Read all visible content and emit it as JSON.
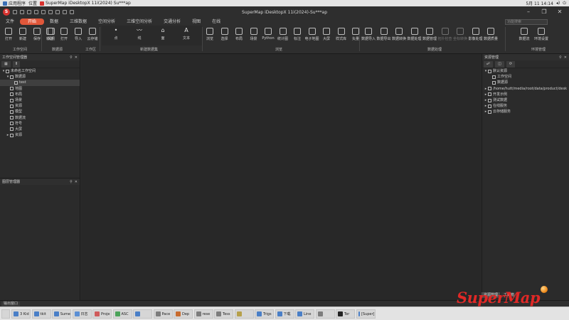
{
  "os_bar": {
    "menu_apps": "应用程序",
    "menu_places": "位置",
    "window_title": "SuperMap iDesktopX 11i(2024) Su***ap",
    "clock": "5月 11 14:14"
  },
  "app": {
    "title": "SuperMap iDesktopX 11i(2024)-Su***ap",
    "logo_letter": "S"
  },
  "menu": {
    "tabs": [
      {
        "label": "文件"
      },
      {
        "label": "开始",
        "active": true
      },
      {
        "label": "数据"
      },
      {
        "label": "三维数据"
      },
      {
        "label": "空间分析"
      },
      {
        "label": "三维空间分析"
      },
      {
        "label": "交通分析"
      },
      {
        "label": "视图"
      },
      {
        "label": "在线"
      }
    ],
    "search_placeholder": "功能搜索"
  },
  "ribbon": {
    "workspace_buttons": [
      "打开",
      "新建",
      "保存",
      "关闭"
    ],
    "datasource_buttons": [
      "新建",
      "打开",
      "导入",
      "云存储"
    ],
    "sketch_items": [
      {
        "glyph": "•",
        "label": "点"
      },
      {
        "glyph": "〰",
        "label": "线"
      },
      {
        "glyph": "⌂",
        "label": "面"
      },
      {
        "glyph": "A",
        "label": "文本"
      }
    ],
    "view_buttons": [
      "浏览",
      "选择",
      "布局",
      "场景",
      "Python",
      "统计图",
      "标注",
      "电子地图",
      "大屏",
      "样式库",
      "矢量"
    ],
    "data_buttons": [
      "数据导入",
      "数据导出",
      "数据转换",
      "数据处理",
      "数据管理",
      "拓扑检查",
      "坐标转换",
      "影像处理",
      "数据质量"
    ],
    "env_buttons": [
      "数据流",
      "环境设置"
    ],
    "group_labels": {
      "workspace": "工作空间",
      "datasource": "数据源",
      "tools": "工作区",
      "sketch": "新建数据集",
      "view": "浏览",
      "data": "数据处理",
      "env": "环境管理"
    }
  },
  "left_panel": {
    "title": "工作空间管理器",
    "toolbar": [
      "▦",
      "Ⅱ"
    ],
    "tree": [
      {
        "label": "未命名工作空间",
        "level": 0,
        "expanded": true
      },
      {
        "label": "数据源",
        "level": 1,
        "expanded": true
      },
      {
        "label": "test",
        "level": 2,
        "selected": true
      },
      {
        "label": "地图",
        "level": 1
      },
      {
        "label": "布局",
        "level": 1
      },
      {
        "label": "场景",
        "level": 1
      },
      {
        "label": "资源",
        "level": 1
      },
      {
        "label": "模型",
        "level": 1
      },
      {
        "label": "数据流",
        "level": 1
      },
      {
        "label": "符号",
        "level": 1
      },
      {
        "label": "大屏",
        "level": 1
      },
      {
        "label": "资源",
        "level": 1
      }
    ]
  },
  "left_panel2": {
    "title": "图层管理器"
  },
  "right_panel": {
    "title": "资源管理",
    "toolbar": [
      "☍",
      "◫",
      "⟳"
    ],
    "tree": [
      {
        "label": "默认资源",
        "level": 0,
        "expanded": true
      },
      {
        "label": "工作空间",
        "level": 1
      },
      {
        "label": "数据源",
        "level": 1
      },
      {
        "label": "/home/hutt/media/root/data/product/desk",
        "level": 0
      },
      {
        "label": "开发示例",
        "level": 0
      },
      {
        "label": "测试数据",
        "level": 0
      },
      {
        "label": "在线服务",
        "level": 0
      },
      {
        "label": "云存储服务",
        "level": 0
      }
    ],
    "tabs": [
      {
        "label": "资源管理",
        "active": true
      },
      {
        "label": "工具箱"
      }
    ]
  },
  "status": {
    "tab_label": "输出窗口"
  },
  "taskbar": {
    "items": [
      "3 Kid",
      "tkit",
      "Sume",
      "日志",
      "Proje",
      "ASC",
      "",
      "Pace",
      "Dep",
      "rese",
      "Tess",
      "",
      "Trigs",
      "下载",
      "Line",
      "",
      "Ter",
      "[Super]"
    ],
    "colors": [
      "#4a7fc7",
      "#4a7fc7",
      "#4a7fc7",
      "#5b8fd4",
      "#cf5b5b",
      "#4ba35a",
      "#4a7fc7",
      "#7d7d7d",
      "#c86b2e",
      "#7d7d7d",
      "#7d7d7d",
      "#b6a04a",
      "#4a7fc7",
      "#4a7fc7",
      "#4a7fc7",
      "#7d7d7d",
      "#222222",
      "#4a7fc7"
    ]
  },
  "watermark": {
    "text": "SuperMap"
  }
}
